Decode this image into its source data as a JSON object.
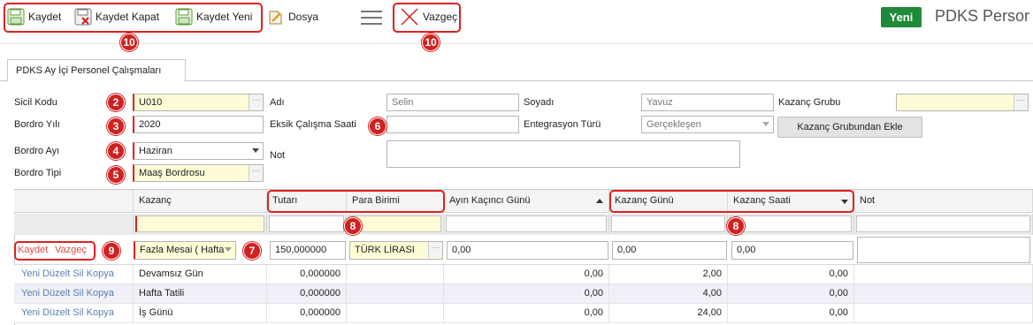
{
  "toolbar": {
    "save": "Kaydet",
    "save_close": "Kaydet Kapat",
    "save_new": "Kaydet Yeni",
    "file": "Dosya",
    "cancel": "Vazgeç",
    "new_badge": "Yeni",
    "app_title": "PDKS Persor"
  },
  "tab": {
    "label": "PDKS Ay İçi Personel Çalışmaları"
  },
  "form": {
    "sicil_label": "Sicil Kodu",
    "sicil_value": "U010",
    "adi_label": "Adı",
    "adi_value": "Selin",
    "soyadi_label": "Soyadı",
    "soyadi_value": "Yavuz",
    "kazanc_grubu_label": "Kazanç Grubu",
    "kazanc_grubu_value": "",
    "yil_label": "Bordro Yılı",
    "yil_value": "2020",
    "eksik_label": "Eksik Çalışma Saati",
    "eksik_value": "",
    "entegrasyon_label": "Entegrasyon Türü",
    "entegrasyon_value": "Gerçekleşen",
    "kazanc_ekle_button": "Kazanç Grubundan Ekle",
    "ay_label": "Bordro Ayı",
    "ay_value": "Haziran",
    "not_label": "Not",
    "not_value": "",
    "tip_label": "Bordro Tipi",
    "tip_value": "Maaş Bordrosu"
  },
  "grid": {
    "columns": [
      "Kazanç",
      "Tutarı",
      "Para Birimi",
      "Ayın Kaçıncı Günü",
      "Kazanç Günü",
      "Kazanç Saati",
      "Not"
    ],
    "edit_row": {
      "save": "Kaydet",
      "cancel": "Vazgeç",
      "kazanc": "Fazla Mesai ( Hafta",
      "tutar": "150,000000",
      "para": "TÜRK LİRASI",
      "ayin_gunu": "0,00",
      "kazanc_gunu": "0,00",
      "kazanc_saati": "0,00",
      "not": ""
    },
    "row_actions": [
      "Yeni",
      "Düzelt",
      "Sil",
      "Kopya"
    ],
    "rows": [
      {
        "kazanc": "Devamsız Gün",
        "tutar": "0,000000",
        "para": "",
        "ayin_gunu": "0,00",
        "kazanc_gunu": "2,00",
        "kazanc_saati": "0,00"
      },
      {
        "kazanc": "Hafta Tatili",
        "tutar": "0,000000",
        "para": "",
        "ayin_gunu": "0,00",
        "kazanc_gunu": "4,00",
        "kazanc_saati": "0,00"
      },
      {
        "kazanc": "İş Günü",
        "tutar": "0,000000",
        "para": "",
        "ayin_gunu": "0,00",
        "kazanc_gunu": "24,00",
        "kazanc_saati": "0,00"
      }
    ]
  },
  "annotations": {
    "b2": "2",
    "b3": "3",
    "b4": "4",
    "b5": "5",
    "b6": "6",
    "b7": "7",
    "b8a": "8",
    "b8b": "8",
    "b9": "9",
    "b10a": "10",
    "b10b": "10"
  },
  "colors": {
    "annotation_red": "#e02020",
    "new_green": "#1e8a3a",
    "link_blue": "#5b7fb3",
    "required_yellow": "#fefcd6"
  }
}
